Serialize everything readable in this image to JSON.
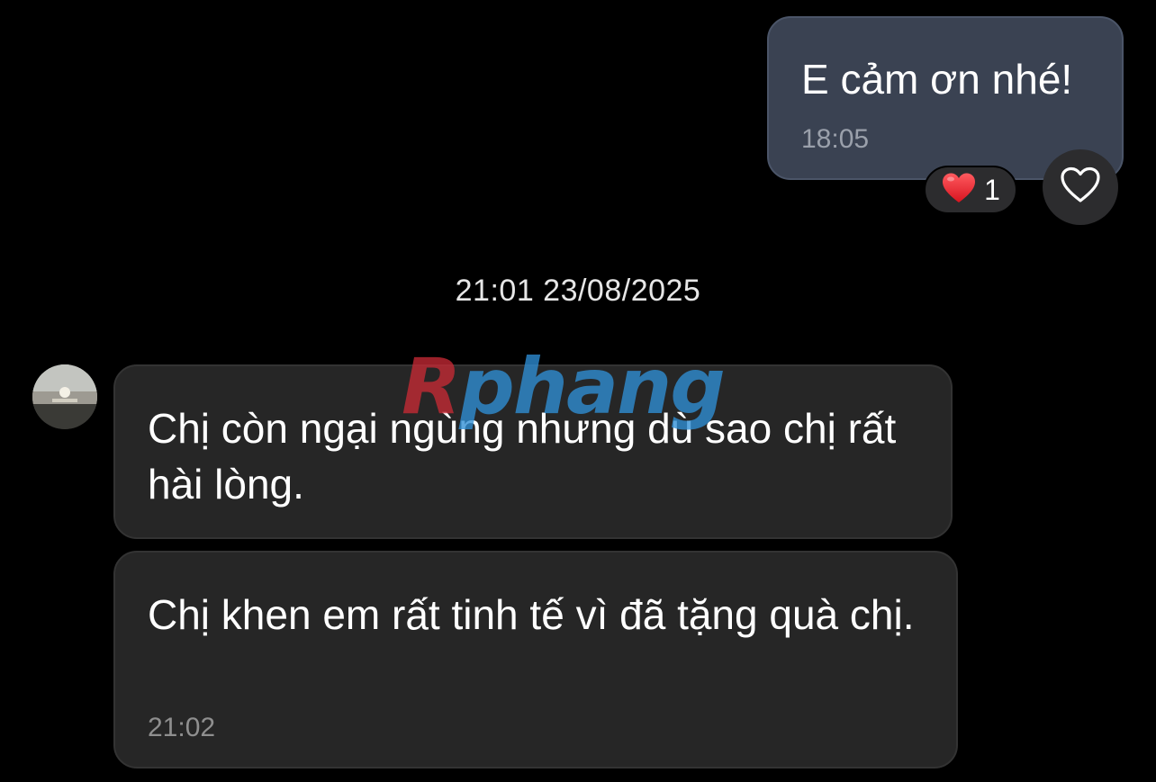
{
  "outgoing": {
    "text": "E cảm ơn nhé!",
    "time": "18:05",
    "reaction": {
      "emoji": "❤️",
      "count": "1"
    }
  },
  "date_separator": "21:01 23/08/2025",
  "incoming": [
    {
      "text": "Chị còn ngại ngùng nhưng dù sao chị rất hài lòng.",
      "time": ""
    },
    {
      "text": "Chị khen em rất tinh tế vì đã tặng quà chị.",
      "time": "21:02"
    }
  ],
  "watermark": {
    "part1": "R",
    "part2": "phang"
  },
  "colors": {
    "background": "#000000",
    "outgoing_bubble": "#3a4252",
    "incoming_bubble": "#262626",
    "watermark_red": "#c62a35",
    "watermark_blue": "#2f8fd6"
  },
  "icons": {
    "react_button": "heart-outline-icon",
    "reaction_emoji": "red-heart-icon"
  }
}
